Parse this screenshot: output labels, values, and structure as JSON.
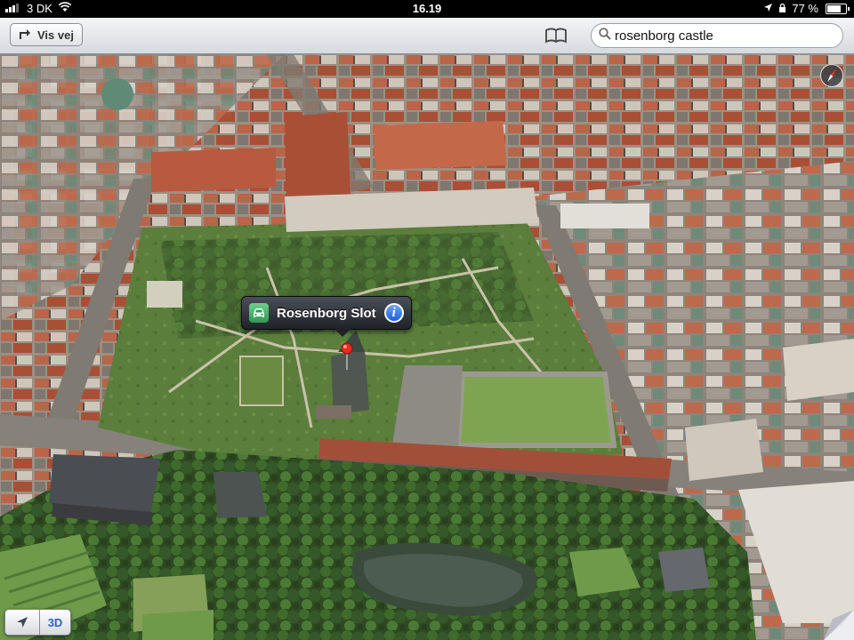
{
  "status_bar": {
    "carrier": "3 DK",
    "time": "16.19",
    "battery": "77 %",
    "battery_level": 0.77,
    "icons": [
      "signal-icon",
      "wifi-icon",
      "location-arrow-icon",
      "lock-icon",
      "battery-icon"
    ]
  },
  "toolbar": {
    "directions_label": "Vis vej",
    "bookmarks_icon": "bookmarks-icon",
    "search": {
      "value": "rosenborg castle",
      "icon": "search-icon"
    }
  },
  "map": {
    "mode": "3D flyover",
    "callout": {
      "title": "Rosenborg Slot",
      "left_icon": "car-icon",
      "right_icon": "info-icon"
    },
    "pin_color": "#e82a1f"
  },
  "controls": {
    "location_icon": "location-arrow-icon",
    "view_toggle_label": "3D",
    "compass_icon": "compass-icon",
    "page_curl_icon": "page-curl-icon"
  },
  "colors": {
    "accent": "#2a62c9",
    "toolbar_top": "#f4f5f7",
    "toolbar_bottom": "#d6d9de"
  }
}
